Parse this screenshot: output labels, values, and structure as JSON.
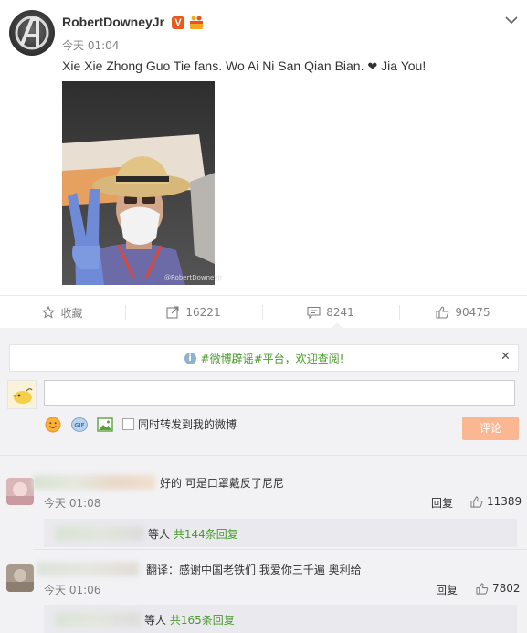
{
  "post": {
    "username": "RobertDowneyJr",
    "verified_badge": "V",
    "timestamp": "今天 01:04",
    "text_main": "Xie Xie Zhong Guo Tie fans. Wo Ai Ni San Qian Bian. ",
    "heart": "❤",
    "text_end": " Jia You!",
    "photo_watermark": "@RobertDowneyJr"
  },
  "actions": {
    "favorite_label": "收藏",
    "repost_count": "16221",
    "comment_count": "8241",
    "like_count": "90475"
  },
  "notice": {
    "info_glyph": "i",
    "link_text": "#微博辟谣#平台，欢迎查阅!",
    "close_glyph": "✕"
  },
  "composer": {
    "gif_label": "GIF",
    "repost_checkbox_label": "同时转发到我的微博",
    "submit_label": "评论"
  },
  "comments": [
    {
      "text": "好的 可是口罩戴反了尼尼",
      "time": "今天 01:08",
      "reply_label": "回复",
      "likes": "11389",
      "sub_suffix": "等人",
      "sub_more": "共144条回复"
    },
    {
      "text": "翻译：感谢中国老铁们 我爱你三千遍 奥利给",
      "time": "今天 01:06",
      "reply_label": "回复",
      "likes": "7802",
      "sub_suffix": "等人",
      "sub_more": "共165条回复"
    }
  ],
  "colors": {
    "accent_green": "#4a9a2d",
    "submit_disabled": "#fbb792",
    "badge_orange": "#e85a1c"
  }
}
